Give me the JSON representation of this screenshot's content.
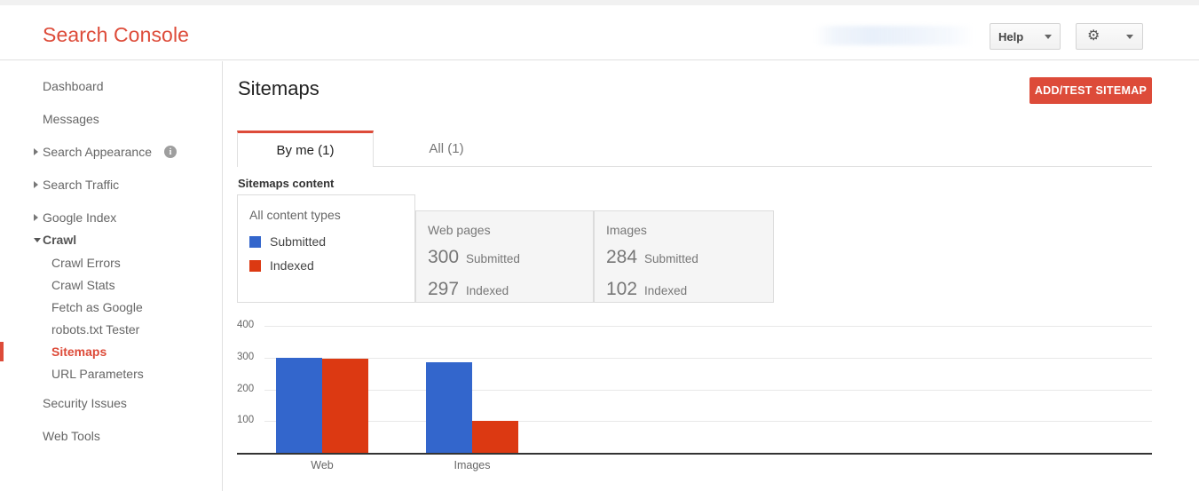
{
  "header": {
    "brand": "Search Console",
    "redacted_site": "",
    "help_label": "Help",
    "gear_icon": "gear-icon",
    "caret_icon": "chevron-down-icon"
  },
  "sidebar": {
    "items": [
      {
        "label": "Dashboard",
        "level": 0,
        "expandable": false,
        "state": "",
        "active": false,
        "info": false
      },
      {
        "label": "Messages",
        "level": 0,
        "expandable": false,
        "state": "",
        "active": false,
        "info": false
      },
      {
        "label": "Search Appearance",
        "level": 0,
        "expandable": true,
        "state": "collapsed",
        "active": false,
        "info": true
      },
      {
        "label": "Search Traffic",
        "level": 0,
        "expandable": true,
        "state": "collapsed",
        "active": false,
        "info": false
      },
      {
        "label": "Google Index",
        "level": 0,
        "expandable": true,
        "state": "collapsed",
        "active": false,
        "info": false
      },
      {
        "label": "Crawl",
        "level": 0,
        "expandable": true,
        "state": "expanded",
        "active": false,
        "info": false
      },
      {
        "label": "Crawl Errors",
        "level": 1,
        "expandable": false,
        "state": "",
        "active": false,
        "info": false
      },
      {
        "label": "Crawl Stats",
        "level": 1,
        "expandable": false,
        "state": "",
        "active": false,
        "info": false
      },
      {
        "label": "Fetch as Google",
        "level": 1,
        "expandable": false,
        "state": "",
        "active": false,
        "info": false
      },
      {
        "label": "robots.txt Tester",
        "level": 1,
        "expandable": false,
        "state": "",
        "active": false,
        "info": false
      },
      {
        "label": "Sitemaps",
        "level": 1,
        "expandable": false,
        "state": "",
        "active": true,
        "info": false
      },
      {
        "label": "URL Parameters",
        "level": 1,
        "expandable": false,
        "state": "",
        "active": false,
        "info": false
      },
      {
        "label": "Security Issues",
        "level": 0,
        "expandable": false,
        "state": "",
        "active": false,
        "info": false
      },
      {
        "label": "Web Tools",
        "level": 0,
        "expandable": false,
        "state": "",
        "active": false,
        "info": false
      }
    ],
    "info_glyph": "i"
  },
  "main": {
    "page_title": "Sitemaps",
    "add_button": "ADD/TEST SITEMAP",
    "tabs": [
      {
        "label": "By me (1)",
        "active": true
      },
      {
        "label": "All (1)",
        "active": false
      }
    ],
    "section_label": "Sitemaps content",
    "legend": {
      "title": "All content types",
      "entries": [
        {
          "label": "Submitted",
          "color": "#3366cc"
        },
        {
          "label": "Indexed",
          "color": "#dc3912"
        }
      ]
    },
    "stats": [
      {
        "title": "Web pages",
        "rows": [
          {
            "value": "300",
            "label": "Submitted"
          },
          {
            "value": "297",
            "label": "Indexed"
          }
        ]
      },
      {
        "title": "Images",
        "rows": [
          {
            "value": "284",
            "label": "Submitted"
          },
          {
            "value": "102",
            "label": "Indexed"
          }
        ]
      }
    ]
  },
  "chart_data": {
    "type": "bar",
    "title": "",
    "xlabel": "",
    "ylabel": "",
    "categories": [
      "Web",
      "Images"
    ],
    "series": [
      {
        "name": "Submitted",
        "color": "#3366cc",
        "values": [
          300,
          284
        ]
      },
      {
        "name": "Indexed",
        "color": "#dc3912",
        "values": [
          297,
          102
        ]
      }
    ],
    "ylim": [
      0,
      400
    ],
    "yticks": [
      400,
      300,
      200,
      100
    ],
    "grid": true,
    "legend_position": "left-panel"
  },
  "colors": {
    "brand_red": "#dd4b39",
    "submitted_blue": "#3366cc",
    "indexed_red": "#dc3912"
  }
}
